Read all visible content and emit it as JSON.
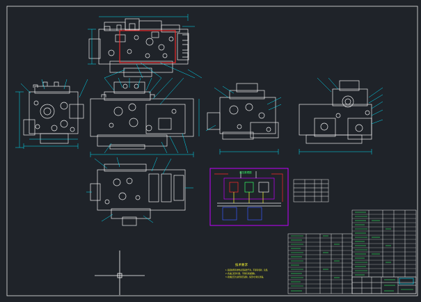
{
  "drawing": {
    "background": "#1f2329",
    "line_color": "#ffffff",
    "accent_colors": {
      "dimension": "#00e5ff",
      "note": "#ffff33",
      "highlight": "#ff2a2a",
      "schematic": "#c000ff",
      "green": "#33ff66",
      "blue": "#3a5cff"
    }
  },
  "views": [
    {
      "id": "top-view",
      "label": ""
    },
    {
      "id": "left-side-view",
      "label": ""
    },
    {
      "id": "front-view",
      "label": ""
    },
    {
      "id": "right-front-view",
      "label": ""
    },
    {
      "id": "right-side-view",
      "label": ""
    },
    {
      "id": "bottom-view",
      "label": ""
    }
  ],
  "schematic": {
    "title": "液压原理图"
  },
  "notes": {
    "title": "技术要求",
    "lines": [
      "1.装配前所有零件必须清洗干净，不得有毛刺、杂质。",
      "2.各油口密封可靠，不得有渗漏现象。",
      "3.按规定压力进行耐压试验，保压5分钟无渗漏。"
    ]
  },
  "title_block": {
    "label": ""
  }
}
